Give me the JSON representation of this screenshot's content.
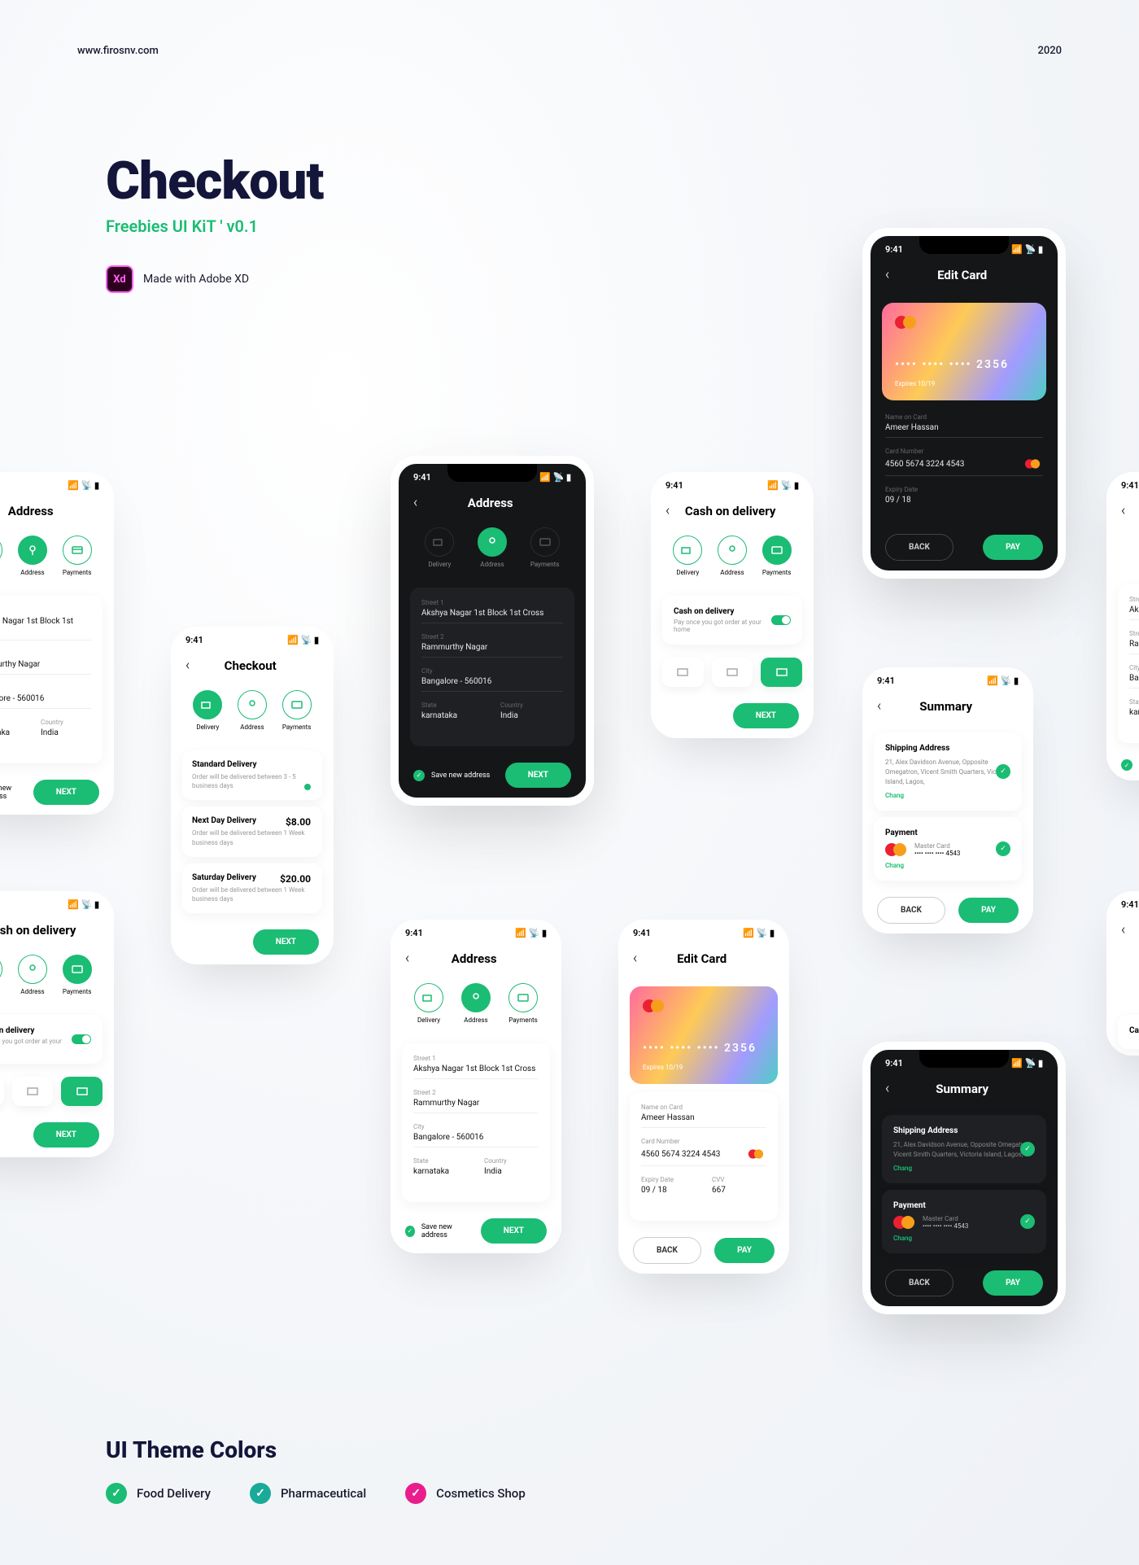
{
  "header": {
    "site": "www.firosnv.com",
    "year": "2020"
  },
  "hero": {
    "title": "Checkout",
    "subtitle": "Freebies UI KiT ' v0.1",
    "made": "Made with Adobe XD",
    "xd": "Xd"
  },
  "footer": {
    "title": "UI Theme Colors",
    "themes": [
      {
        "label": "Food Delivery"
      },
      {
        "label": "Pharmaceutical"
      },
      {
        "label": "Cosmetics Shop"
      }
    ]
  },
  "statusbar": {
    "time": "9:41"
  },
  "steps": {
    "delivery": "Delivery",
    "address": "Address",
    "payments": "Payments"
  },
  "address": {
    "title": "Address",
    "street1_label": "Street 1",
    "street1_val": "Akshya Nagar 1st Block 1st Cross",
    "street2_label": "Street 2",
    "street2_val": "Rammurthy Nagar",
    "city_label": "City",
    "city_val": "Bangalore - 560016",
    "state_label": "State",
    "state_val": "karnataka",
    "country_label": "Country",
    "country_val": "India",
    "save_label": "Save new address",
    "next": "NEXT"
  },
  "checkout": {
    "title": "Checkout",
    "standard": {
      "title": "Standard Delivery",
      "desc": "Order will be delivered between 3 - 5 business days"
    },
    "nextday": {
      "title": "Next Day Delivery",
      "desc": "Order will be delivered between 1 Week business days",
      "price": "$8.00"
    },
    "saturday": {
      "title": "Saturday Delivery",
      "desc": "Order will be delivered between 1 Week business days",
      "price": "$20.00"
    },
    "next": "NEXT"
  },
  "cod": {
    "title": "Cash on delivery",
    "card_title": "Cash on delivery",
    "card_desc": "Pay once you got order at your home",
    "next": "NEXT"
  },
  "editcard": {
    "title": "Edit Card",
    "name_label": "Name on Card",
    "name_val": "Ameer Hassan",
    "num_label": "Card Number",
    "num_val": "4560  5674  3224  4543",
    "exp_label": "Expiry Date",
    "exp_val": "09 / 18",
    "cvv_label": "CVV",
    "cvv_val": "667",
    "card_display_num": "•••• •••• •••• 2356",
    "card_display_exp": "Expires 10/19",
    "back": "BACK",
    "pay": "PAY"
  },
  "summary": {
    "title": "Summary",
    "ship_title": "Shipping Address",
    "ship_body": "21, Alex Davidson Avenue, Opposite Omegatron, Vicent Smith Quarters, Victoria Island, Lagos,",
    "change": "Chang",
    "pay_title": "Payment",
    "pay_brand": "Master Card",
    "pay_num": "•••• •••• •••• 4543",
    "back": "BACK",
    "pay": "PAY"
  }
}
